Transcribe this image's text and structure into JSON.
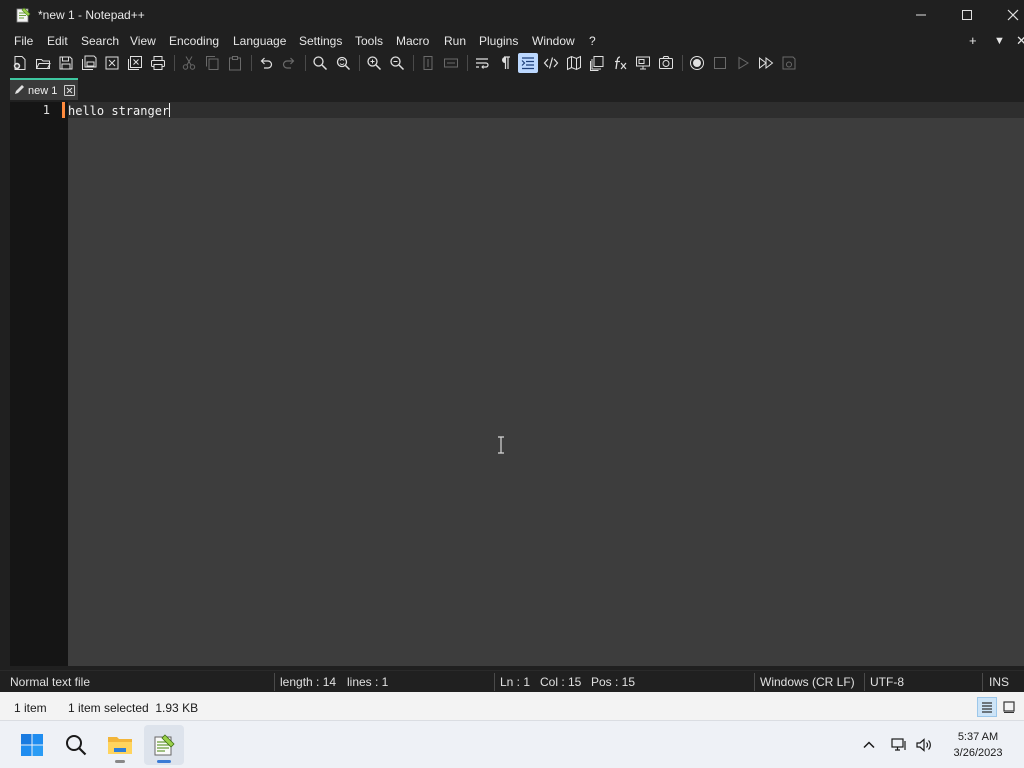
{
  "window": {
    "title": "*new 1 - Notepad++",
    "controls": {
      "minimize": "minimize-icon",
      "maximize": "maximize-icon",
      "close": "close-icon"
    }
  },
  "menu": {
    "items": [
      "File",
      "Edit",
      "Search",
      "View",
      "Encoding",
      "Language",
      "Settings",
      "Tools",
      "Macro",
      "Run",
      "Plugins",
      "Window",
      "?"
    ],
    "right": [
      "+",
      "▼",
      "✕"
    ]
  },
  "toolbar": {
    "buttons": [
      "new-file",
      "open-file",
      "save",
      "save-all",
      "close",
      "close-all",
      "print",
      "cut",
      "copy",
      "paste",
      "undo",
      "redo",
      "find",
      "replace",
      "zoom-in",
      "zoom-out",
      "sync-vertical",
      "sync-horizontal",
      "word-wrap",
      "show-all-characters",
      "indent-guide",
      "udl",
      "document-map",
      "document-list",
      "function-list",
      "folder-as-workspace",
      "monitoring",
      "record-macro",
      "stop-macro",
      "playback-macro",
      "run-macro-multiple",
      "save-macro"
    ],
    "active_button": "indent-guide"
  },
  "tabs": [
    {
      "label": "new 1",
      "modified": true
    }
  ],
  "editor": {
    "lines": [
      {
        "number": "1",
        "text": "hello stranger"
      }
    ]
  },
  "statusbar": {
    "file_type": "Normal text file",
    "length": "length : 14",
    "lines": "lines : 1",
    "ln": "Ln : 1",
    "col": "Col : 15",
    "pos": "Pos : 15",
    "eol": "Windows (CR LF)",
    "encoding": "UTF-8",
    "mode": "INS"
  },
  "explorer": {
    "item_count": "1 item",
    "selection": "1 item selected  1.93 KB"
  },
  "taskbar": {
    "time": "5:37 AM",
    "date": "3/26/2023"
  },
  "colors": {
    "tab_accent": "#3ec7a0",
    "change_marker": "#ff8a3d",
    "editor_bg": "#3d3d3d",
    "gutter_bg": "#151515",
    "toolbar_active": "#bcd8ff"
  }
}
